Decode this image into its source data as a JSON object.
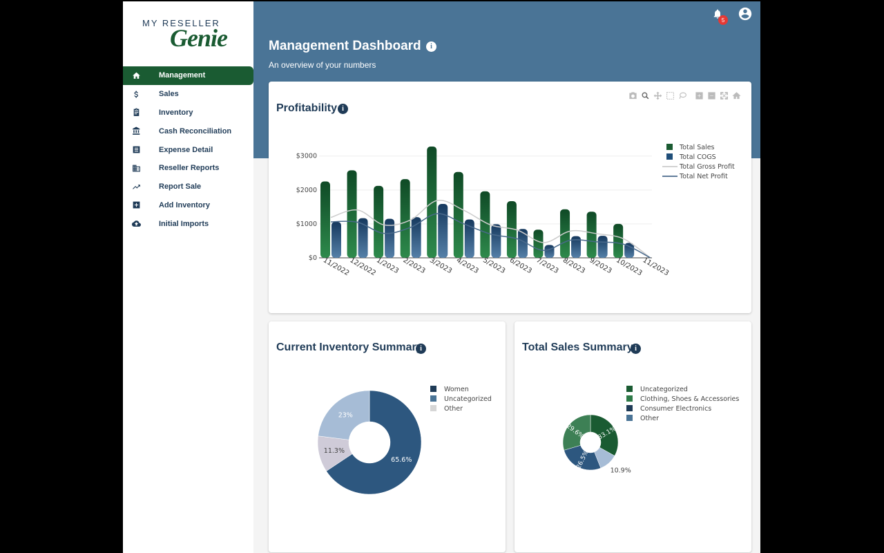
{
  "logo": {
    "top": "MY RESELLER",
    "bottom": "Genie"
  },
  "sidebar": {
    "items": [
      {
        "label": "Management",
        "icon": "home-icon",
        "active": true
      },
      {
        "label": "Sales",
        "icon": "dollar-icon"
      },
      {
        "label": "Inventory",
        "icon": "clipboard-icon"
      },
      {
        "label": "Cash Reconciliation",
        "icon": "bank-icon"
      },
      {
        "label": "Expense Detail",
        "icon": "list-icon"
      },
      {
        "label": "Reseller Reports",
        "icon": "building-icon"
      },
      {
        "label": "Report Sale",
        "icon": "trending-icon"
      },
      {
        "label": "Add Inventory",
        "icon": "plus-box-icon"
      },
      {
        "label": "Initial Imports",
        "icon": "cloud-upload-icon"
      }
    ]
  },
  "header": {
    "title": "Management Dashboard",
    "subtitle": "An overview of your numbers",
    "notification_count": "5"
  },
  "colors": {
    "brand_green": "#1a5b32",
    "header_blue": "#4a7496",
    "navy": "#1f3b57"
  },
  "profitability": {
    "title": "Profitability"
  },
  "inventory_summary": {
    "title": "Current Inventory Summary"
  },
  "sales_summary": {
    "title": "Total Sales Summary"
  },
  "chart_data": [
    {
      "type": "bar",
      "categories": [
        "11/2022",
        "12/2022",
        "1/2023",
        "2/2023",
        "3/2023",
        "4/2023",
        "5/2023",
        "6/2023",
        "7/2023",
        "8/2023",
        "9/2023",
        "10/2023",
        "11/2023"
      ],
      "ytick_labels": [
        "$0",
        "$1000",
        "$2000",
        "$3000"
      ],
      "ylim": [
        0,
        3300
      ],
      "legend_position": "right",
      "series": [
        {
          "name": "Total Sales",
          "kind": "bar",
          "color": "#1a5b32",
          "values": [
            2250,
            2580,
            2120,
            2320,
            3280,
            2530,
            1960,
            1670,
            830,
            1430,
            1360,
            1000,
            0
          ]
        },
        {
          "name": "Total COGS",
          "kind": "bar",
          "color": "#1f4e79",
          "values": [
            1060,
            1170,
            1150,
            1200,
            1590,
            1130,
            990,
            850,
            380,
            640,
            650,
            440,
            0
          ]
        },
        {
          "name": "Total Gross Profit",
          "kind": "line",
          "color": "#cccccc",
          "values": [
            1190,
            1410,
            970,
            1120,
            1690,
            1400,
            970,
            820,
            450,
            790,
            710,
            560,
            0
          ]
        },
        {
          "name": "Total Net Profit",
          "kind": "line",
          "color": "#4a6a8c",
          "values": [
            1060,
            1050,
            720,
            900,
            1300,
            1000,
            700,
            560,
            220,
            520,
            470,
            400,
            0
          ]
        }
      ]
    },
    {
      "type": "pie",
      "hole": true,
      "legend_position": "right",
      "slices": [
        {
          "label": "Women",
          "value": 65.6,
          "text": "65.6%",
          "color": "#2d577f"
        },
        {
          "label": "Uncategorized",
          "value": 11.3,
          "text": "11.3%",
          "color": "#cfcbd8"
        },
        {
          "label": "Other",
          "value": 23.0,
          "text": "23%",
          "color": "#a6bcd6"
        }
      ],
      "legend": [
        {
          "label": "Women",
          "color": "#1f3b57"
        },
        {
          "label": "Uncategorized",
          "color": "#4a7496"
        },
        {
          "label": "Other",
          "color": "#d6d6d6"
        }
      ]
    },
    {
      "type": "pie",
      "hole": true,
      "legend_position": "right",
      "slices": [
        {
          "label": "Uncategorized",
          "value": 33.1,
          "text": "33.1%",
          "color": "#1a5b32"
        },
        {
          "label": "Other",
          "value": 10.9,
          "text": "10.9%",
          "color": "#a6bcd6"
        },
        {
          "label": "Consumer Electronics",
          "value": 26.5,
          "text": "26.5%",
          "color": "#2d577f"
        },
        {
          "label": "Clothing, Shoes & Accessories",
          "value": 29.6,
          "text": "29.6%",
          "color": "#3d8055"
        }
      ],
      "legend": [
        {
          "label": "Uncategorized",
          "color": "#1a5b32"
        },
        {
          "label": "Clothing, Shoes & Accessories",
          "color": "#2e7a48"
        },
        {
          "label": "Consumer Electronics",
          "color": "#1f3b57"
        },
        {
          "label": "Other",
          "color": "#4a7496"
        }
      ]
    }
  ]
}
